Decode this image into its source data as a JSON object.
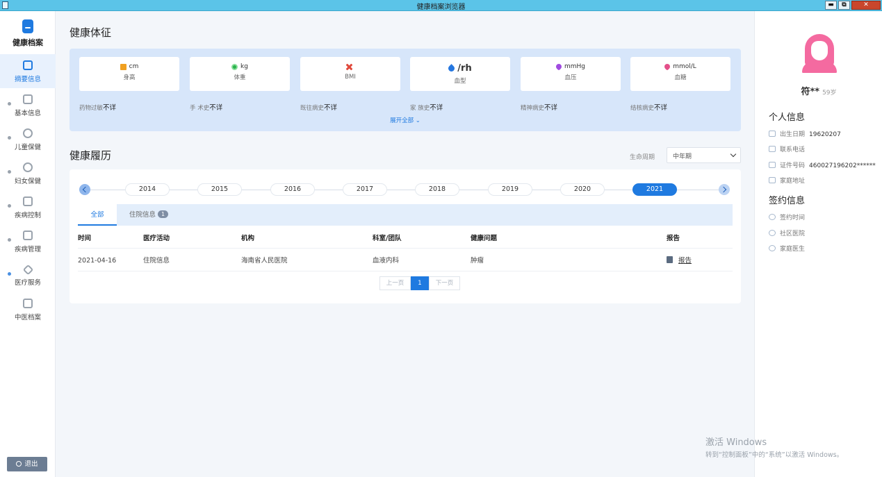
{
  "window": {
    "title": "健康档案浏览器",
    "min": "▬",
    "max": "⧉",
    "close": "✕"
  },
  "sidebar": {
    "brand": "健康档案",
    "items": [
      {
        "label": "摘要信息",
        "icon": "scan-icon",
        "active": true
      },
      {
        "label": "基本信息",
        "icon": "document-icon"
      },
      {
        "label": "儿童保健",
        "icon": "child-icon"
      },
      {
        "label": "妇女保健",
        "icon": "woman-icon"
      },
      {
        "label": "疾病控制",
        "icon": "medkit-icon"
      },
      {
        "label": "疾病管理",
        "icon": "gear-icon"
      },
      {
        "label": "医疗服务",
        "icon": "diamond-icon"
      },
      {
        "label": "中医档案",
        "icon": "document-icon"
      }
    ],
    "logout": "退出"
  },
  "vitals": {
    "title": "健康体征",
    "cards": [
      {
        "unit": "cm",
        "label": "身高",
        "icon": "ruler-icon"
      },
      {
        "unit": "kg",
        "label": "体重",
        "icon": "scale-icon"
      },
      {
        "unit": "",
        "label": "BMI",
        "icon": "bmi-icon"
      },
      {
        "unit": "/rh",
        "label": "血型",
        "icon": "drop-icon"
      },
      {
        "unit": "mmHg",
        "label": "血压",
        "icon": "heart-icon"
      },
      {
        "unit": "mmol/L",
        "label": "血糖",
        "icon": "sugar-icon"
      }
    ],
    "history": [
      {
        "label": "药物过敏",
        "value": "不详"
      },
      {
        "label": "手 术史",
        "value": "不详"
      },
      {
        "label": "既往病史",
        "value": "不详"
      },
      {
        "label": "家 族史",
        "value": "不详"
      },
      {
        "label": "精神病史",
        "value": "不详"
      },
      {
        "label": "结核病史",
        "value": "不详"
      }
    ],
    "expand": "展开全部 ⌄"
  },
  "records": {
    "title": "健康履历",
    "lifecycle_label": "生命周期",
    "lifecycle_value": "中年期",
    "years": [
      "2014",
      "2015",
      "2016",
      "2017",
      "2018",
      "2019",
      "2020",
      "2021"
    ],
    "active_year": "2021",
    "tabs": [
      {
        "label": "全部",
        "active": true
      },
      {
        "label": "住院信息",
        "badge": "1"
      }
    ],
    "columns": [
      "时间",
      "医疗活动",
      "机构",
      "科室/团队",
      "健康问题",
      "报告"
    ],
    "rows": [
      {
        "time": "2021-04-16",
        "activity": "住院信息",
        "org": "海南省人民医院",
        "dept": "血液内科",
        "problem": "肿瘤",
        "report": "报告"
      }
    ],
    "pager": {
      "prev": "上一页",
      "page": "1",
      "next": "下一页"
    }
  },
  "profile": {
    "name": "符**",
    "age": "59岁",
    "personal_title": "个人信息",
    "personal": [
      {
        "label": "出生日期",
        "value": "19620207",
        "icon": "calendar-icon"
      },
      {
        "label": "联系电话",
        "value": "",
        "icon": "phone-icon"
      },
      {
        "label": "证件号码",
        "value": "460027196202******",
        "icon": "id-card-icon"
      },
      {
        "label": "家庭地址",
        "value": "",
        "icon": "home-icon"
      }
    ],
    "contract_title": "签约信息",
    "contract": [
      {
        "label": "签约时间",
        "icon": "clock-icon"
      },
      {
        "label": "社区医院",
        "icon": "hospital-icon"
      },
      {
        "label": "家庭医生",
        "icon": "doctor-icon"
      }
    ]
  },
  "watermark": {
    "line1": "激活 Windows",
    "line2": "转到“控制面板”中的“系统”以激活 Windows。"
  }
}
